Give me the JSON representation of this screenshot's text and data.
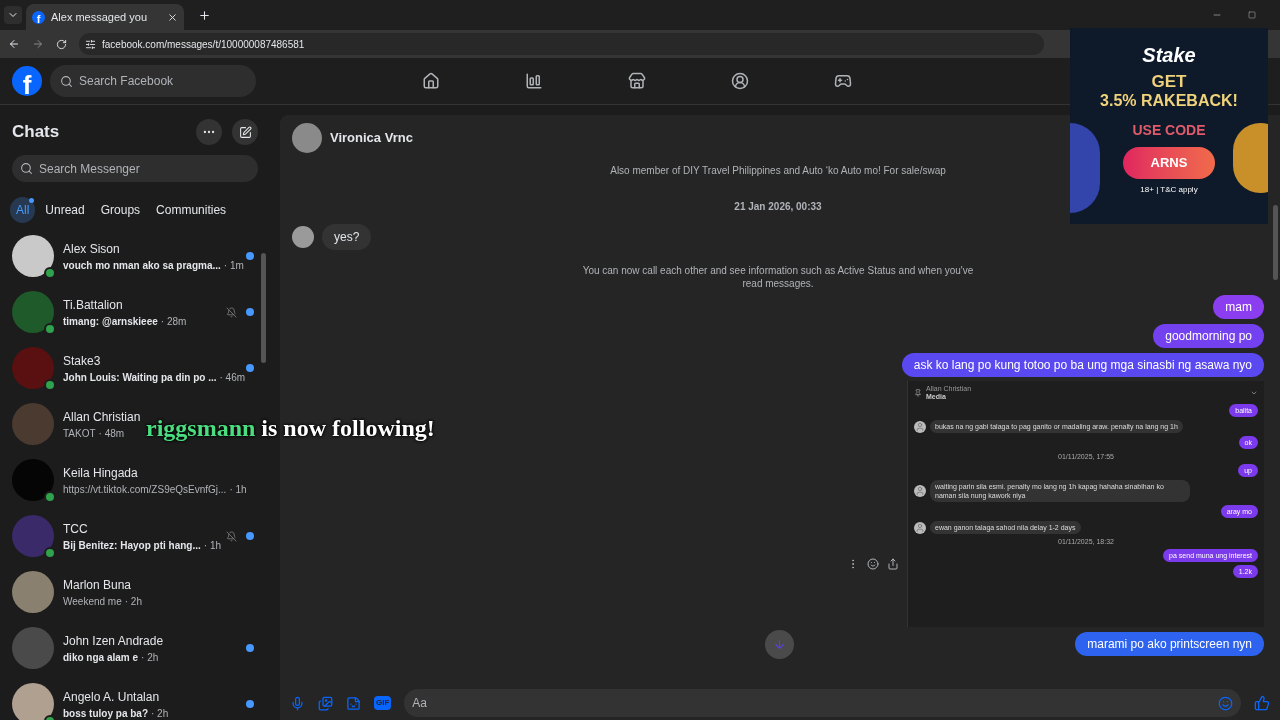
{
  "browser": {
    "favicon_letter": "f",
    "tab_title": "Alex messaged you",
    "url": "facebook.com/messages/t/100000087486581"
  },
  "header": {
    "logo_letter": "f",
    "search_placeholder": "Search Facebook"
  },
  "sidebar": {
    "title": "Chats",
    "search_placeholder": "Search Messenger",
    "filters": [
      {
        "label": "All",
        "selected": true
      },
      {
        "label": "Unread",
        "selected": false
      },
      {
        "label": "Groups",
        "selected": false
      },
      {
        "label": "Communities",
        "selected": false
      }
    ],
    "chats": [
      {
        "name": "Alex Sison",
        "preview": "vouch mo nman ako sa pragma...",
        "time": "· 1m",
        "online": true,
        "unread": true,
        "muted": false
      },
      {
        "name": "Ti.Battalion",
        "preview": "timang: @arnskieee",
        "time": "· 28m",
        "online": true,
        "unread": true,
        "muted": true
      },
      {
        "name": "Stake3",
        "preview": "John Louis: Waiting pa din po ...",
        "time": "· 46m",
        "online": true,
        "unread": true,
        "muted": false
      },
      {
        "name": "Allan Christian",
        "preview": "TAKOT",
        "time": "· 48m",
        "online": false,
        "unread": false,
        "muted": false
      },
      {
        "name": "Keila Hingada",
        "preview": "https://vt.tiktok.com/ZS9eQsEvnfGj...",
        "time": "· 1h",
        "online": true,
        "unread": false,
        "muted": false
      },
      {
        "name": "TCC",
        "preview": "Bij Benitez: Hayop pti hang...",
        "time": "· 1h",
        "online": true,
        "unread": true,
        "muted": true
      },
      {
        "name": "Marlon Buna",
        "preview": "Weekend me",
        "time": "· 2h",
        "online": false,
        "unread": false,
        "muted": false
      },
      {
        "name": "John Izen Andrade",
        "preview": "diko nga alam e",
        "time": "· 2h",
        "online": false,
        "unread": true,
        "muted": false
      },
      {
        "name": "Angelo A. Untalan",
        "preview": "boss tuloy pa ba?",
        "time": "· 2h",
        "online": true,
        "unread": true,
        "muted": false
      }
    ]
  },
  "conversation": {
    "name": "Vironica Vrnc",
    "messages": [
      {
        "kind": "info",
        "text": "Also member of DIY Travel Philippines and Auto ‘ko Auto mo! For sale/swap"
      },
      {
        "kind": "timestamp",
        "text": "21 Jan 2026, 00:33"
      },
      {
        "kind": "incoming",
        "text": "yes?"
      },
      {
        "kind": "info",
        "text": "You can now call each other and see information such as Active Status and when you've read messages."
      },
      {
        "kind": "outgoing",
        "text": "mam"
      },
      {
        "kind": "outgoing",
        "text": "goodmorning po"
      },
      {
        "kind": "outgoing",
        "text": "ask ko lang po kung totoo po ba ung mga sinasbi ng asawa nyo"
      },
      {
        "kind": "image",
        "name": "Allan Christian",
        "subtitle": "Media",
        "items": [
          {
            "kind": "outgoing",
            "text": "balita"
          },
          {
            "kind": "incoming",
            "text": "bukas na ng gabi talaga to pag ganito or madaling araw. penalty na lang ng 1h"
          },
          {
            "kind": "outgoing",
            "text": "ok"
          },
          {
            "kind": "timestamp",
            "text": "01/11/2025, 17:55"
          },
          {
            "kind": "outgoing",
            "text": "up"
          },
          {
            "kind": "incoming",
            "text": "waiting parin sila esmi. penalty mo lang ng 1h kapag hahaha sinabihan ko naman sila nung kawork niya"
          },
          {
            "kind": "outgoing",
            "text": "aray mo"
          },
          {
            "kind": "incoming",
            "text": "ewan ganon talaga sahod nila delay 1-2 days"
          },
          {
            "kind": "timestamp",
            "text": "01/11/2025, 18:32"
          },
          {
            "kind": "outgoing",
            "text": "pa send muna ung interest"
          },
          {
            "kind": "outgoing",
            "text": "1.2k"
          }
        ]
      },
      {
        "kind": "outgoing",
        "text": "marami po ako printscreen nyn"
      }
    ],
    "gif_label": "GIF",
    "composer_placeholder": "Aa"
  },
  "follow_alert": {
    "username": "riggsmann",
    "message": "is now following!"
  },
  "ad": {
    "logo": "Stake",
    "headline": "GET",
    "offer": "3.5% RAKEBACK!",
    "code_label": "USE CODE",
    "code": "ARNS",
    "disclaimer": "18+ | T&C apply"
  }
}
